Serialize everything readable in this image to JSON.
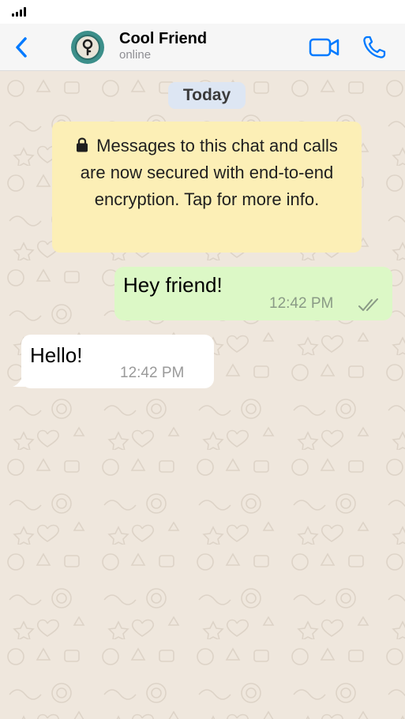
{
  "header": {
    "contact_name": "Cool Friend",
    "contact_status": "online",
    "icons": {
      "back": "chevron-left-icon",
      "avatar": "key-icon",
      "video": "video-camera-icon",
      "call": "phone-icon",
      "signal": "signal-bars-icon"
    },
    "accent_color": "#007aff"
  },
  "chat": {
    "date_label": "Today",
    "encryption_notice": "Messages to this chat and calls are now secured with end-to-end encryption. Tap for more info.",
    "messages": [
      {
        "direction": "outgoing",
        "text": "Hey friend!",
        "time": "12:42 PM",
        "status": "read-ticks-icon"
      },
      {
        "direction": "incoming",
        "text": "Hello!",
        "time": "12:42 PM"
      }
    ],
    "colors": {
      "background": "#efe7dd",
      "outgoing_bubble": "#dcf8c6",
      "incoming_bubble": "#ffffff",
      "notice_bubble": "#fcefb6",
      "date_pill": "#dde6f3"
    }
  }
}
